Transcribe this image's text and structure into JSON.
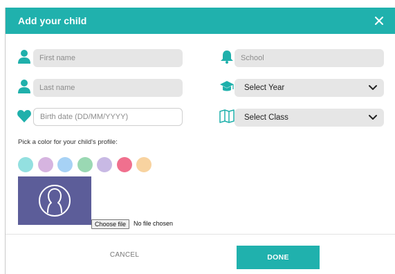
{
  "header": {
    "title": "Add your child"
  },
  "form": {
    "first_name": {
      "placeholder": "First name",
      "icon": "person-icon"
    },
    "last_name": {
      "placeholder": "Last name",
      "icon": "person-icon"
    },
    "birth_date": {
      "placeholder": "Birth date (DD/MM/YYYY)",
      "icon": "heart-icon"
    },
    "school": {
      "placeholder": "School",
      "icon": "bell-icon"
    },
    "year": {
      "selected": "Select Year",
      "icon": "graduation-cap-icon"
    },
    "class": {
      "selected": "Select Class",
      "icon": "book-icon"
    }
  },
  "color_picker": {
    "label": "Pick a color for your child's profile:",
    "colors": [
      "#93e0e0",
      "#d6b4e0",
      "#a7d2f5",
      "#9ad8b3",
      "#c8b9e4",
      "#f0708e",
      "#f8d3a0"
    ]
  },
  "avatar": {
    "background": "#5c5d99",
    "icon": "user-silhouette-icon"
  },
  "file_input": {
    "button_label": "Choose file",
    "status": "No file chosen"
  },
  "footer": {
    "cancel_label": "CANCEL",
    "done_label": "DONE"
  },
  "theme": {
    "accent": "#20b1ad",
    "icon_color": "#1fb0ab"
  }
}
